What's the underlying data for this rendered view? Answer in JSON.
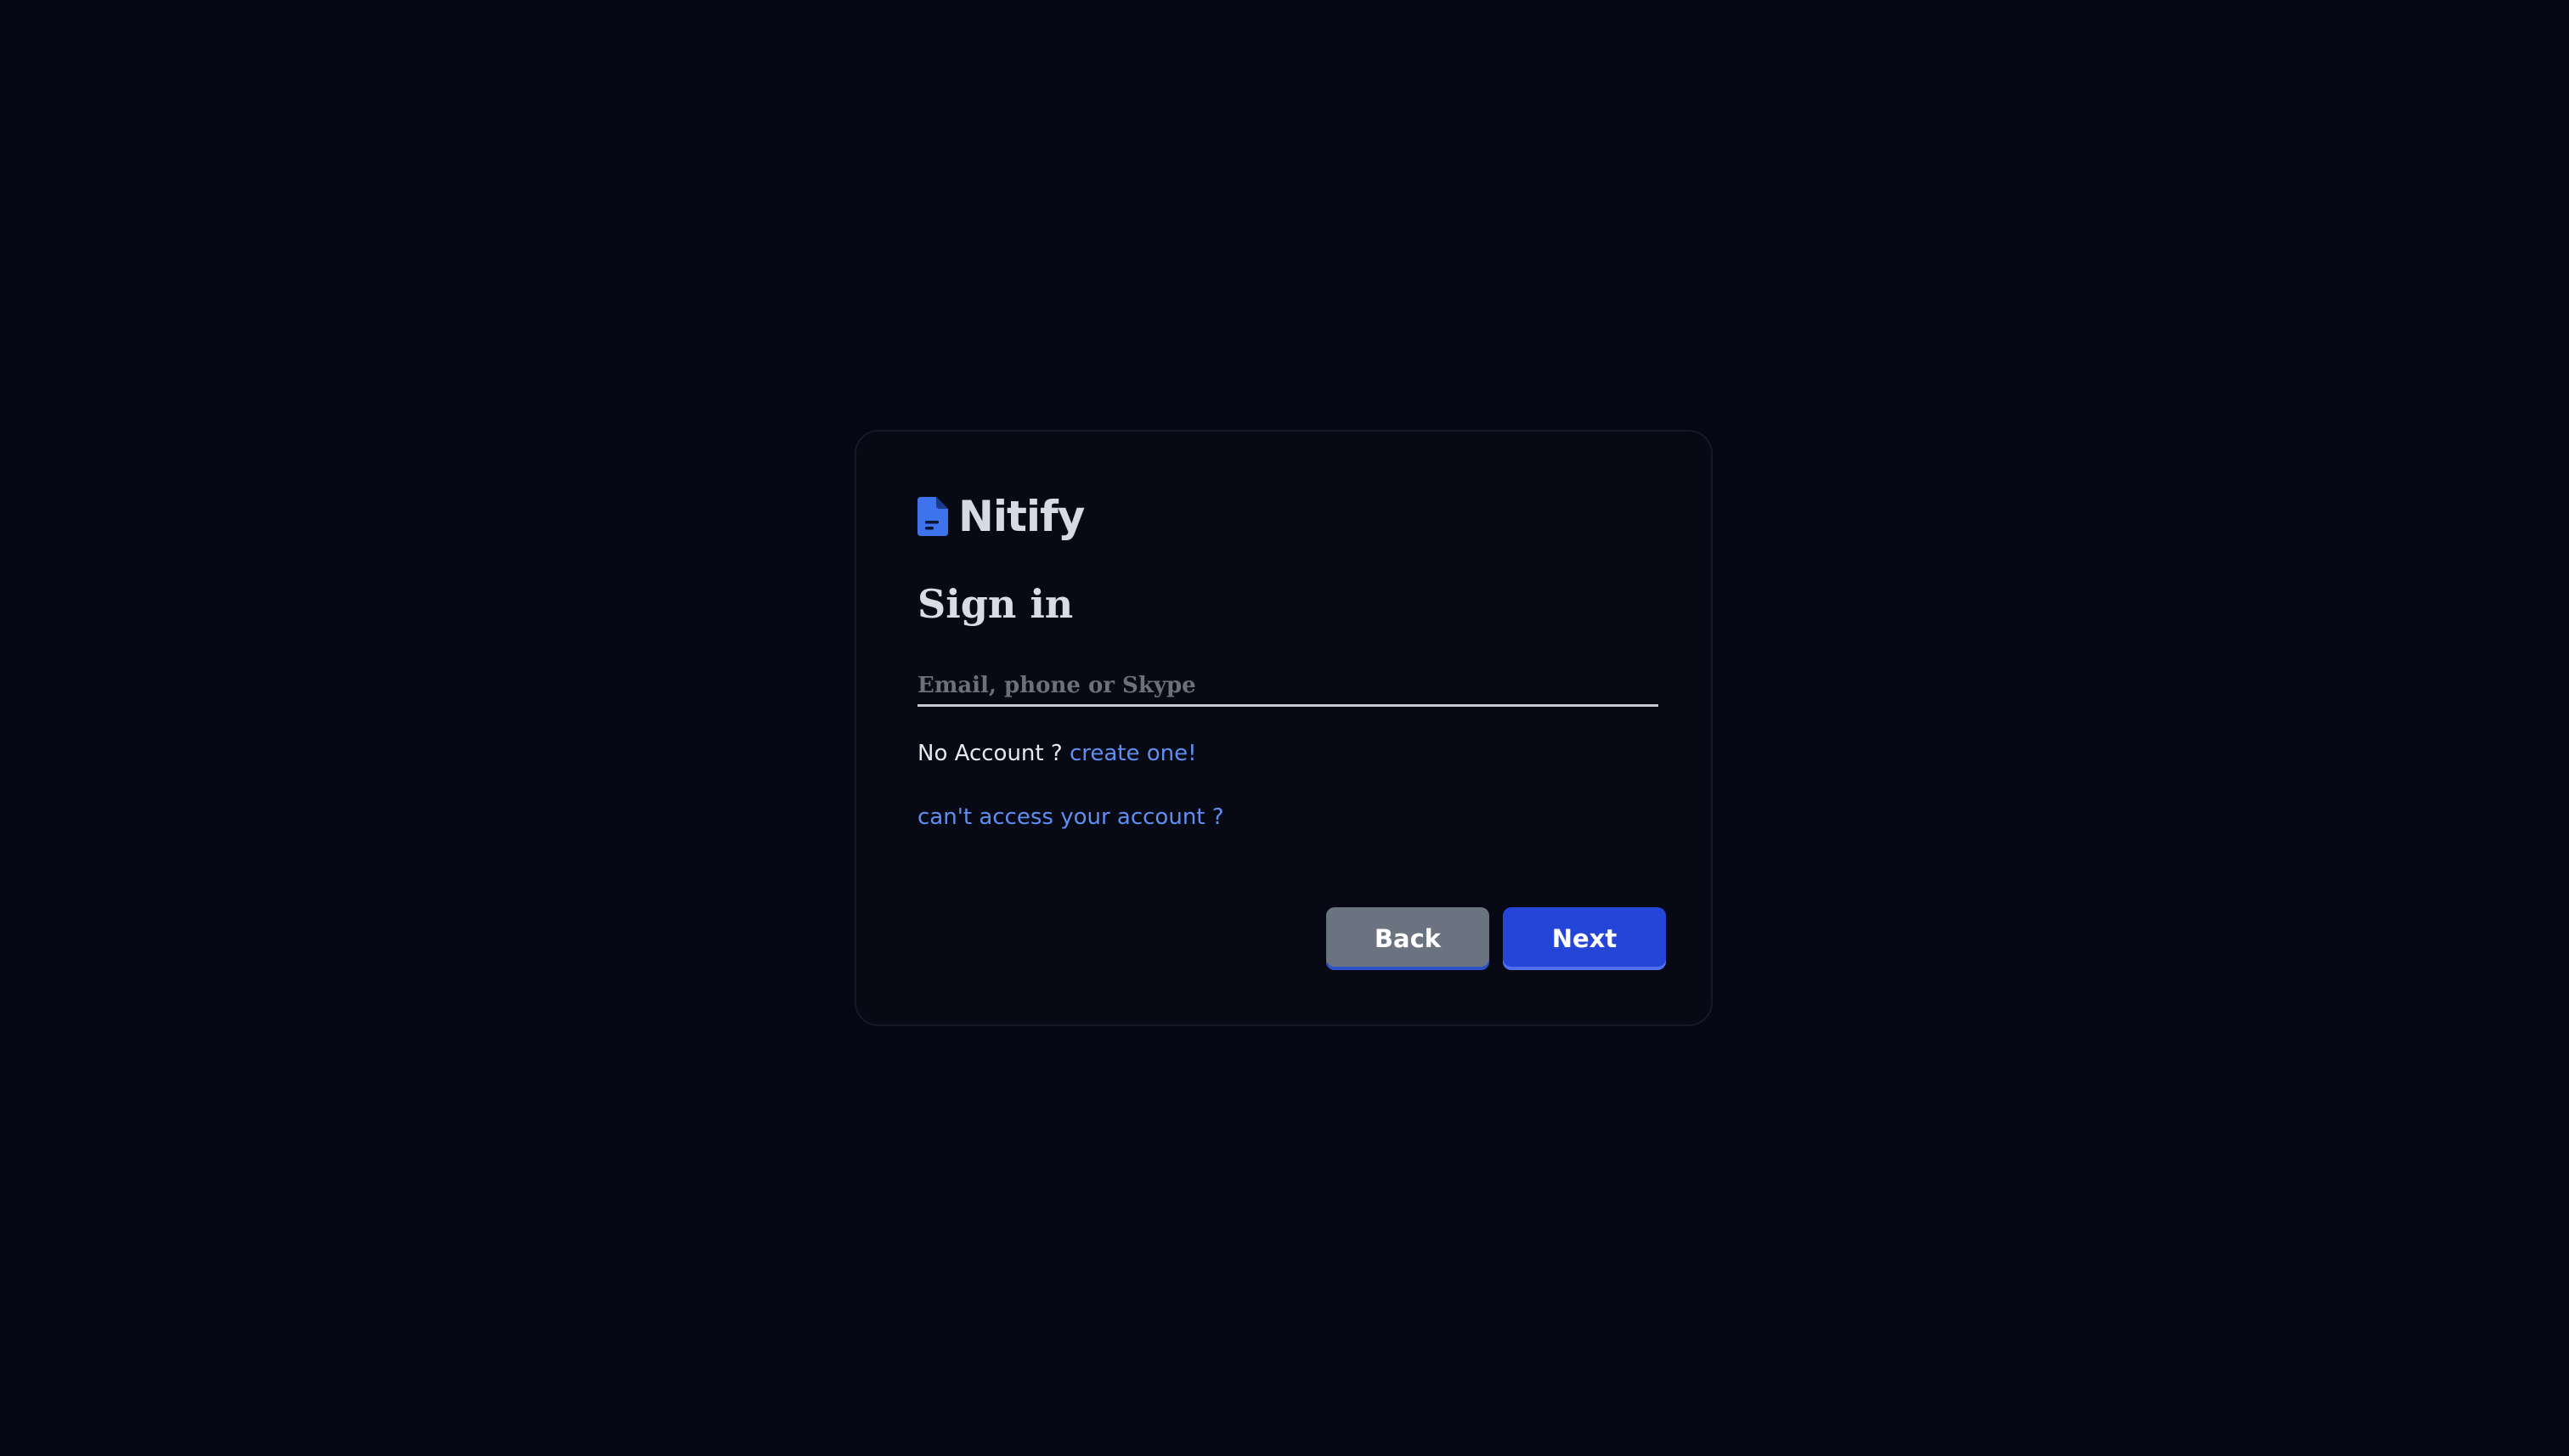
{
  "brand": {
    "name": "Nitify",
    "accent_color": "#3d74ee",
    "icon": "document-icon"
  },
  "signin": {
    "title": "Sign in",
    "email_placeholder": "Email, phone or Skype",
    "email_value": "",
    "no_account_text": "No Account ?",
    "create_link": "create one!",
    "cant_access_link": "can't access your account ?"
  },
  "buttons": {
    "back_label": "Back",
    "next_label": "Next"
  },
  "colors": {
    "background": "#050814",
    "card": "#070a15",
    "link": "#5f8ff2",
    "back_button": "#6c7380",
    "next_button": "#2545d8"
  }
}
